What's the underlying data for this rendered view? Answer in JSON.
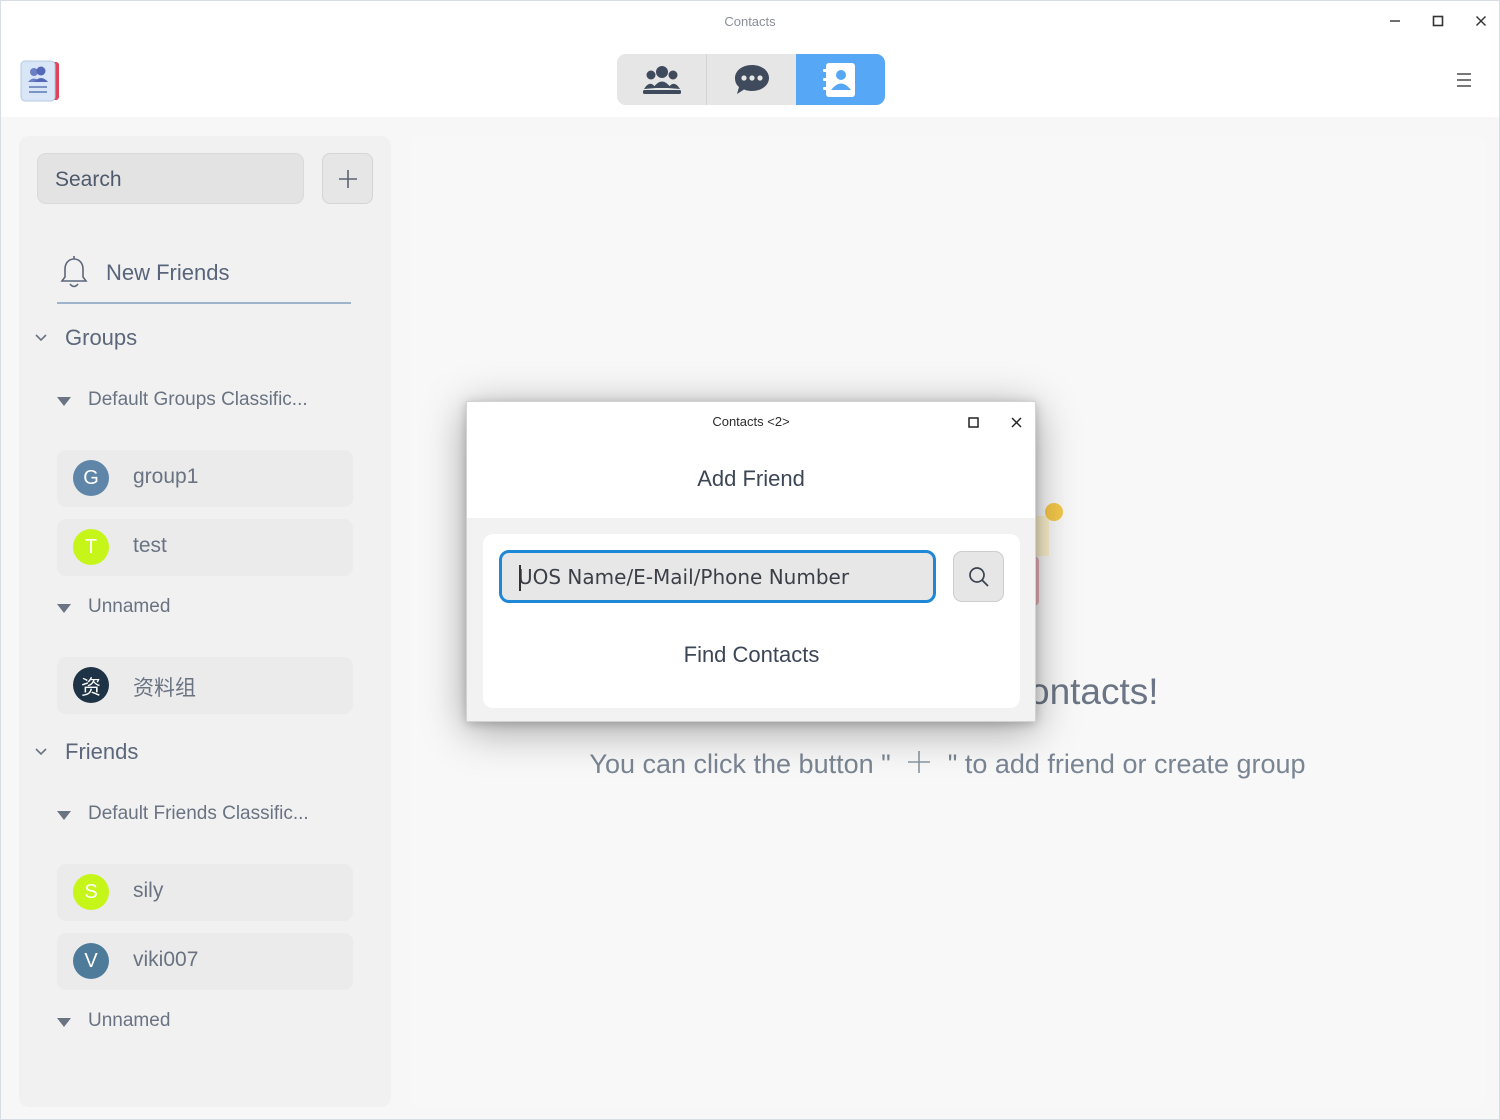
{
  "window": {
    "title": "Contacts"
  },
  "topnav": {
    "tabs": [
      {
        "icon": "groups-icon",
        "active": false
      },
      {
        "icon": "chat-icon",
        "active": false
      },
      {
        "icon": "contacts-icon",
        "active": true
      }
    ]
  },
  "sidebar": {
    "search_placeholder": "Search",
    "new_friends_label": "New Friends",
    "groups": {
      "label": "Groups",
      "subsections": [
        {
          "label": "Default Groups Classific...",
          "items": [
            {
              "name": "group1",
              "avatar_letter": "G",
              "avatar_color": "#5f86a8"
            },
            {
              "name": "test",
              "avatar_letter": "T",
              "avatar_color": "#c6f51a"
            }
          ]
        },
        {
          "label": "Unnamed",
          "items": [
            {
              "name": "资料组",
              "avatar_letter": "资",
              "avatar_color": "#1f3346"
            }
          ]
        }
      ]
    },
    "friends": {
      "label": "Friends",
      "subsections": [
        {
          "label": "Default Friends Classific...",
          "items": [
            {
              "name": "sily",
              "avatar_letter": "S",
              "avatar_color": "#c6f51a"
            },
            {
              "name": "viki007",
              "avatar_letter": "V",
              "avatar_color": "#4f7b9b"
            }
          ]
        },
        {
          "label": "Unnamed",
          "items": []
        }
      ]
    }
  },
  "main": {
    "empty_title": "ontacts!",
    "empty_hint_before": "You can click the button \"",
    "empty_hint_after": "\" to add friend or create group"
  },
  "dialog": {
    "title": "Contacts <2>",
    "heading": "Add Friend",
    "input_value": "UOS Name/E-Mail/Phone Number",
    "find_label": "Find Contacts"
  },
  "colors": {
    "accent": "#56a7f5",
    "focus_border": "#1f88d6"
  }
}
